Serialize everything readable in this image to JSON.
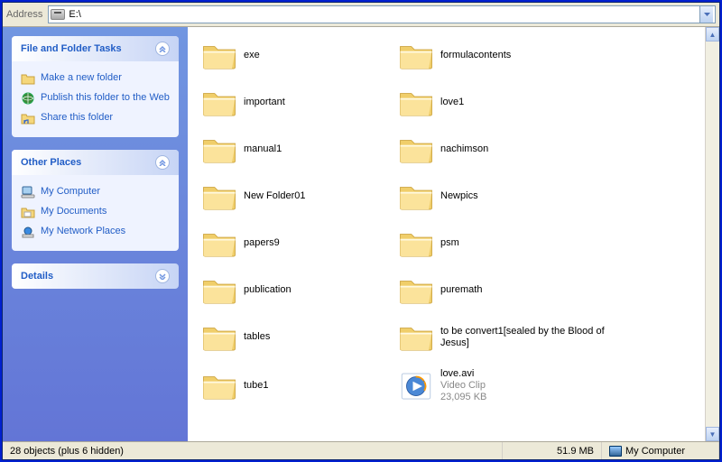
{
  "address": {
    "label": "Address",
    "path": "E:\\"
  },
  "sidebar": {
    "panels": [
      {
        "title": "File and Folder Tasks",
        "expanded": true,
        "tasks": [
          {
            "icon": "folder-new",
            "label": "Make a new folder"
          },
          {
            "icon": "globe",
            "label": "Publish this folder to the Web"
          },
          {
            "icon": "share",
            "label": "Share this folder"
          }
        ]
      },
      {
        "title": "Other Places",
        "expanded": true,
        "tasks": [
          {
            "icon": "computer",
            "label": "My Computer"
          },
          {
            "icon": "folder-docs",
            "label": "My Documents"
          },
          {
            "icon": "network",
            "label": "My Network Places"
          }
        ]
      },
      {
        "title": "Details",
        "expanded": false,
        "tasks": []
      }
    ]
  },
  "items": [
    {
      "type": "folder",
      "name": "exe"
    },
    {
      "type": "folder",
      "name": "formulacontents"
    },
    {
      "type": "folder",
      "name": "important"
    },
    {
      "type": "folder",
      "name": "love1"
    },
    {
      "type": "folder",
      "name": "manual1"
    },
    {
      "type": "folder",
      "name": "nachimson"
    },
    {
      "type": "folder",
      "name": "New Folder01"
    },
    {
      "type": "folder",
      "name": "Newpics"
    },
    {
      "type": "folder",
      "name": "papers9"
    },
    {
      "type": "folder",
      "name": "psm"
    },
    {
      "type": "folder",
      "name": "publication"
    },
    {
      "type": "folder",
      "name": "puremath"
    },
    {
      "type": "folder",
      "name": "tables"
    },
    {
      "type": "folder",
      "name": "to be convert1[sealed by the Blood of Jesus]"
    },
    {
      "type": "folder",
      "name": "tube1"
    },
    {
      "type": "video",
      "name": "love.avi",
      "kind": "Video Clip",
      "size": "23,095 KB"
    }
  ],
  "status": {
    "objects": "28 objects (plus 6 hidden)",
    "size": "51.9 MB",
    "location": "My Computer"
  }
}
